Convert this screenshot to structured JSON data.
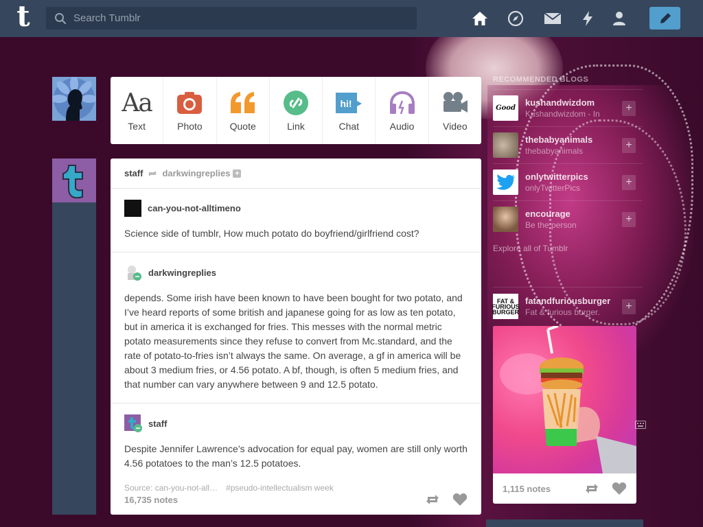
{
  "header": {
    "logo_letter": "t",
    "search_placeholder": "Search Tumblr",
    "nav_icons": [
      "home-icon",
      "explore-icon",
      "inbox-icon",
      "activity-icon",
      "account-icon"
    ],
    "compose_icon": "pencil-icon"
  },
  "composer": {
    "types": [
      {
        "label": "Text",
        "glyph": "Aa",
        "color": "#444444"
      },
      {
        "label": "Photo",
        "color": "#d95e40"
      },
      {
        "label": "Quote",
        "glyph": "““",
        "color": "#f2992e"
      },
      {
        "label": "Link",
        "color": "#56bc8a"
      },
      {
        "label": "Chat",
        "glyph": "hi!",
        "color": "#529ecc"
      },
      {
        "label": "Audio",
        "color": "#a77dc2"
      },
      {
        "label": "Video",
        "color": "#748089"
      }
    ]
  },
  "post": {
    "author": "staff",
    "reblogged_from": "darkwingreplies",
    "reblogs": [
      {
        "user": "can-you-not-alltimeno",
        "body": "Science side of tumblr, How much potato do boyfriend/girlfriend cost?"
      },
      {
        "user": "darkwingreplies",
        "body": "depends. Some irish have been known to have been bought for two potato, and I’ve heard reports of some british and japanese going for as low as ten potato, but in america it is exchanged for fries. This messes with the normal metric potato measurements since they refuse to convert from Mc.standard, and the rate of potato-to-fries isn’t always the same. On average, a gf in america will be about 3 medium fries, or 4.56 potato. A bf, though, is often 5 medium fries, and that number can vary anywhere between 9 and 12.5 potato."
      },
      {
        "user": "staff",
        "body": "Despite Jennifer Lawrence’s advocation for equal pay, women are still only worth 4.56 potatoes to the man’s 12.5 potatoes."
      }
    ],
    "source": "Source: can-you-not-all…",
    "tag": "#pseudo-intellectualism week",
    "notes": "16,735 notes"
  },
  "sidebar": {
    "title": "RECOMMENDED BLOGS",
    "blogs": [
      {
        "name": "kushandwizdom",
        "desc": "Kushandwizdom - In"
      },
      {
        "name": "thebabyanimals",
        "desc": "thebabyanimals"
      },
      {
        "name": "onlytwitterpics",
        "desc": "onlyTwitterPics"
      },
      {
        "name": "encourage",
        "desc": "Be the person"
      }
    ],
    "explore": "Explore all of Tumblr",
    "radar": {
      "name": "fatandfuriousburger",
      "desc": "Fat & furious burger.",
      "thumb_text": "FAT & FURIOUS BURGER",
      "notes": "1,115 notes"
    }
  }
}
